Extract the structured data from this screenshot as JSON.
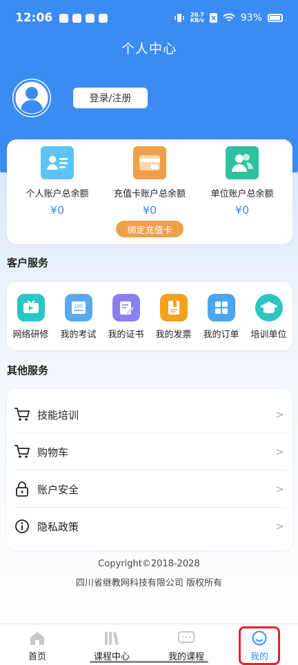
{
  "status_bar": {
    "time": "12:06",
    "net_speed_top": "20.7",
    "net_speed_bottom": "KB/s",
    "battery": "93%"
  },
  "header": {
    "title": "个人中心",
    "login_label": "登录/注册"
  },
  "balances": [
    {
      "label": "个人账户总余额",
      "amount": "¥0",
      "color": "#5cc3f5",
      "icon": "id-card-icon"
    },
    {
      "label": "充值卡账户总余额",
      "amount": "¥0",
      "color": "#f0a04b",
      "icon": "recharge-card-icon"
    },
    {
      "label": "单位账户总余额",
      "amount": "¥0",
      "color": "#2fc0a0",
      "icon": "group-users-icon"
    }
  ],
  "bind_card_label": "绑定充值卡",
  "customer_service": {
    "title": "客户服务",
    "items": [
      {
        "label": "网络研修",
        "color": "#28c7c7",
        "icon": "video-icon"
      },
      {
        "label": "我的考试",
        "color": "#5aa8f2",
        "icon": "exam-paper-icon"
      },
      {
        "label": "我的证书",
        "color": "#8b7ff0",
        "icon": "certificate-icon"
      },
      {
        "label": "我的发票",
        "color": "#f3a21c",
        "icon": "invoice-book-icon"
      },
      {
        "label": "我的订单",
        "color": "#4aa6f0",
        "icon": "order-grid-icon"
      },
      {
        "label": "培训单位",
        "color": "#2cc4c4",
        "icon": "graduation-cap-icon"
      }
    ]
  },
  "other_service": {
    "title": "其他服务",
    "items": [
      {
        "label": "技能培训",
        "icon": "cart-icon"
      },
      {
        "label": "购物车",
        "icon": "cart-icon"
      },
      {
        "label": "账户安全",
        "icon": "lock-icon"
      },
      {
        "label": "隐私政策",
        "icon": "info-icon"
      }
    ],
    "chevron": ">"
  },
  "footer": {
    "copyright": "Copyright©2018-2028",
    "company": "四川省继教网科技有限公司 版权所有"
  },
  "tabs": [
    {
      "label": "首页",
      "icon": "home-icon"
    },
    {
      "label": "课程中心",
      "icon": "books-icon"
    },
    {
      "label": "我的课程",
      "icon": "chat-icon"
    },
    {
      "label": "我的",
      "icon": "smiley-icon",
      "active": true
    }
  ],
  "colors": {
    "primary": "#3b8bf5",
    "accent_orange": "#f0a04b",
    "highlight": "#e0232a"
  }
}
